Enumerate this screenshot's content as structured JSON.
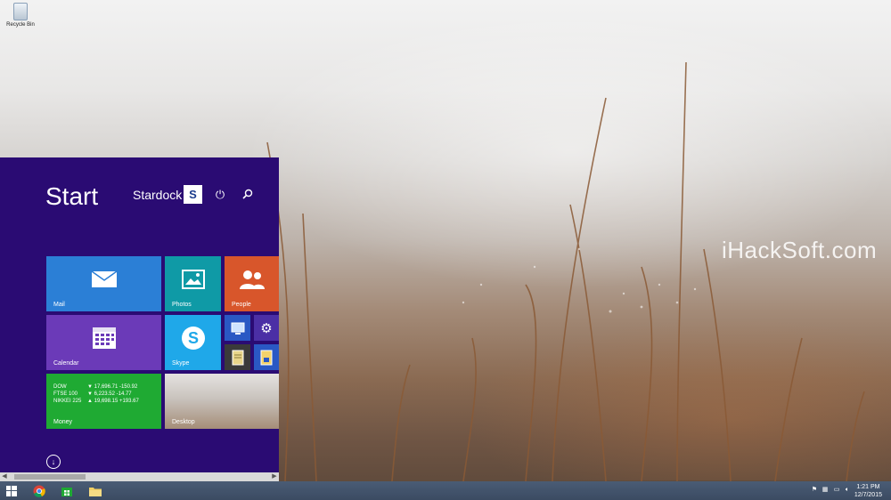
{
  "desktop": {
    "recycle_bin_label": "Recycle Bin",
    "watermark": "iHackSoft.com"
  },
  "start": {
    "title": "Start",
    "user_name": "Stardock",
    "user_avatar_icon": "stardock-logo-icon",
    "power_icon": "power-icon",
    "search_icon": "search-icon",
    "all_apps_icon": "arrow-down-circle-icon",
    "tiles": {
      "mail": "Mail",
      "photos": "Photos",
      "people": "People",
      "calendar": "Calendar",
      "skype": "Skype",
      "money": "Money",
      "desktop": "Desktop"
    },
    "money": [
      {
        "index": "DOW",
        "value": "▼ 17,696.71 -150.92"
      },
      {
        "index": "FTSE 100",
        "value": "▼ 6,223.52 -14.77"
      },
      {
        "index": "NIKKEI 225",
        "value": "▲ 19,698.15 +193.67"
      }
    ]
  },
  "taskbar": {
    "time": "1:21 PM",
    "date": "12/7/2015",
    "colors": {
      "start_bg": "#2a0b73",
      "taskbar_bg": "#3b4b62"
    }
  }
}
